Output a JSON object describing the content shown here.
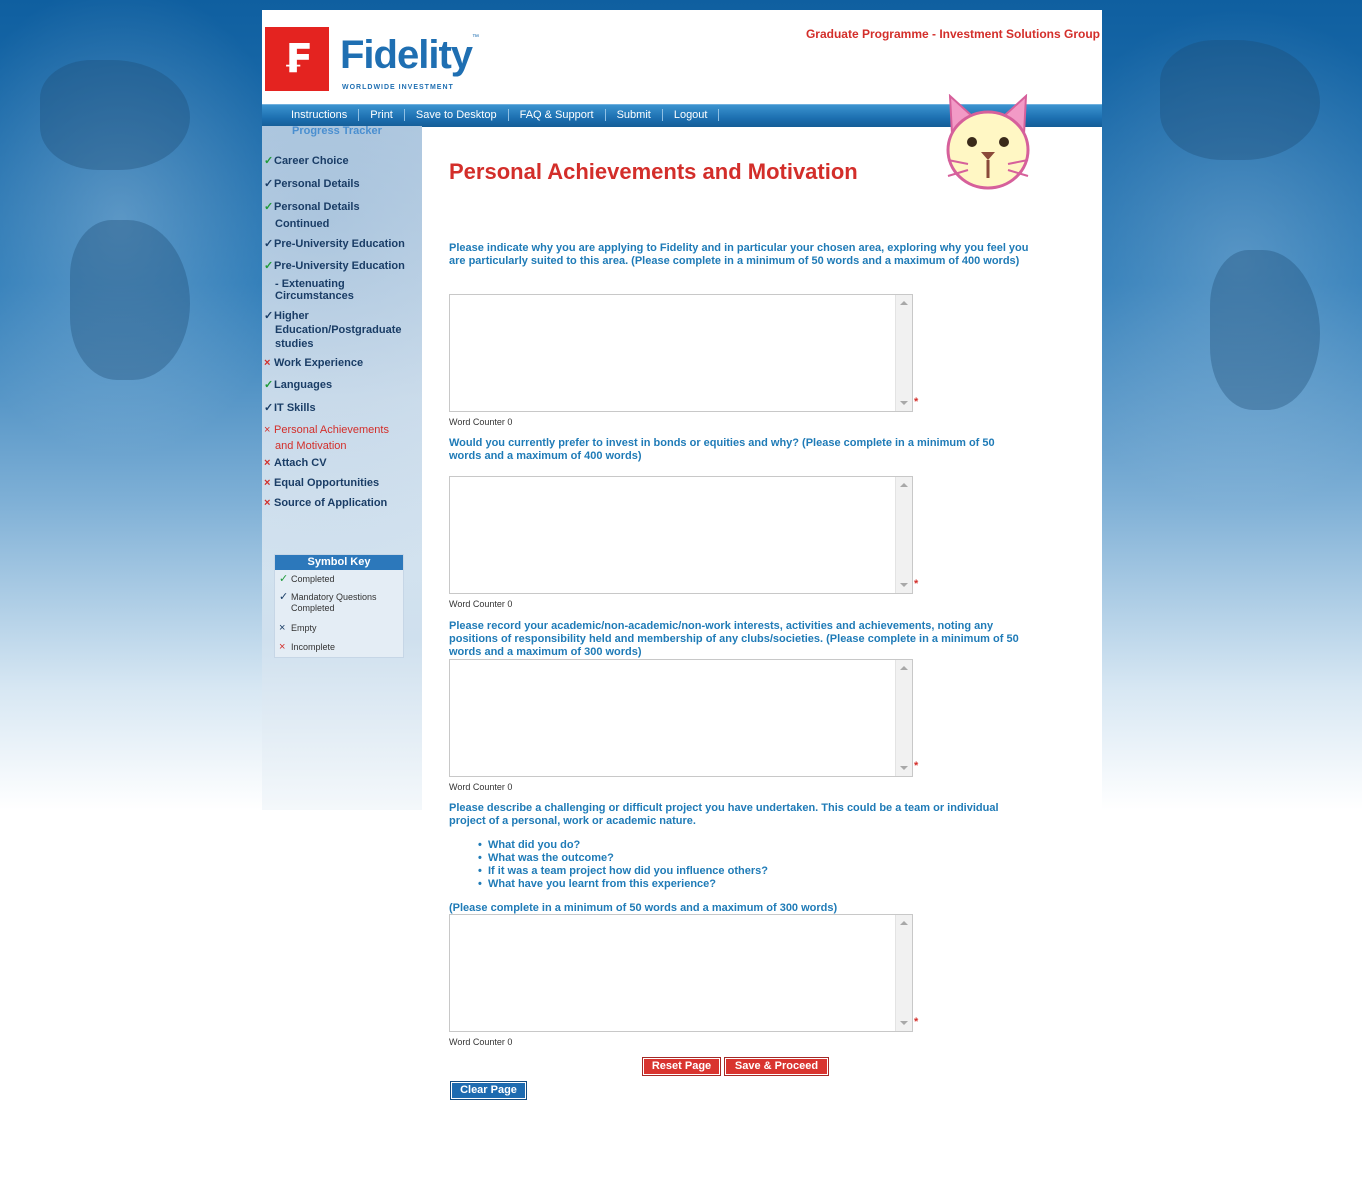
{
  "header": {
    "logo_glyph": "₣",
    "logo_word": "Fidelity",
    "logo_tm": "™",
    "logo_sub": "WORLDWIDE INVESTMENT",
    "title": "Graduate Programme - Investment Solutions Group"
  },
  "nav": {
    "items": [
      "Instructions",
      "Print",
      "Save to Desktop",
      "FAQ & Support",
      "Submit",
      "Logout"
    ]
  },
  "sidebar": {
    "title": "Progress Tracker",
    "items": [
      {
        "status": "completed",
        "mark": "✓",
        "line1": "Career Choice",
        "line2": ""
      },
      {
        "status": "mandatory",
        "mark": "✓",
        "line1": "Personal Details",
        "line2": ""
      },
      {
        "status": "completed",
        "mark": "✓",
        "line1": "Personal Details",
        "line2": "Continued"
      },
      {
        "status": "mandatory",
        "mark": "✓",
        "line1": "Pre-University Education",
        "line2": ""
      },
      {
        "status": "completed",
        "mark": "✓",
        "line1": "Pre-University Education",
        "line2": "- Extenuating Circumstances"
      },
      {
        "status": "mandatory",
        "mark": "✓",
        "line1": "Higher",
        "line2": "Education/Postgraduate studies"
      },
      {
        "status": "incomplete",
        "mark": "×",
        "line1": "Work Experience",
        "line2": ""
      },
      {
        "status": "completed",
        "mark": "✓",
        "line1": "Languages",
        "line2": ""
      },
      {
        "status": "mandatory",
        "mark": "✓",
        "line1": "IT Skills",
        "line2": ""
      },
      {
        "status": "incomplete",
        "mark": "×",
        "line1": "Personal Achievements",
        "line2": "and Motivation"
      },
      {
        "status": "incomplete",
        "mark": "×",
        "line1": "Attach CV",
        "line2": ""
      },
      {
        "status": "incomplete",
        "mark": "×",
        "line1": "Equal Opportunities",
        "line2": ""
      },
      {
        "status": "incomplete",
        "mark": "×",
        "line1": "Source of Application",
        "line2": ""
      }
    ]
  },
  "symbol_key": {
    "title": "Symbol Key",
    "rows": [
      {
        "mark": "✓",
        "label": "Completed"
      },
      {
        "mark": "✓",
        "label": "Mandatory Questions Completed"
      },
      {
        "mark": "×",
        "label": "Empty"
      },
      {
        "mark": "×",
        "label": "Incomplete"
      }
    ]
  },
  "main": {
    "title": "Personal Achievements and Motivation",
    "questions": [
      {
        "text": "Please indicate why you are applying to Fidelity and in particular your chosen area, exploring why you feel you are particularly suited to this area. (Please complete in a minimum of 50 words and a maximum of 400 words)",
        "value": "",
        "word_counter": "Word Counter  0"
      },
      {
        "text": "Would you currently prefer to invest in bonds or equities and why? (Please complete in a minimum of 50 words and a maximum of 400 words)",
        "value": "",
        "word_counter": "Word Counter  0"
      },
      {
        "text": "Please record your academic/non-academic/non-work interests, activities and achievements, noting any positions of responsibility held and membership of any clubs/societies. (Please complete in a minimum of 50 words and a maximum of 300 words)",
        "value": "",
        "word_counter": "Word Counter  0"
      },
      {
        "text": "Please describe a challenging or difficult project you have undertaken. This could be a team or individual project of a personal, work or academic nature.",
        "value": "",
        "word_counter": "Word Counter  0"
      }
    ],
    "q4_bullets": [
      "What did you do?",
      "What was the outcome?",
      "If it was a team project how did you influence others?",
      "What have you learnt from this experience?"
    ],
    "q4_limit": "(Please complete in a minimum of 50 words and a maximum of 300 words)",
    "required_mark": "*"
  },
  "buttons": {
    "reset": "Reset Page",
    "save": "Save & Proceed",
    "clear": "Clear Page"
  },
  "colors": {
    "brand_red": "#d32e2a",
    "brand_blue": "#1f6fb2",
    "question_blue": "#1f7bb7",
    "completed_green": "#1f9b3a"
  }
}
